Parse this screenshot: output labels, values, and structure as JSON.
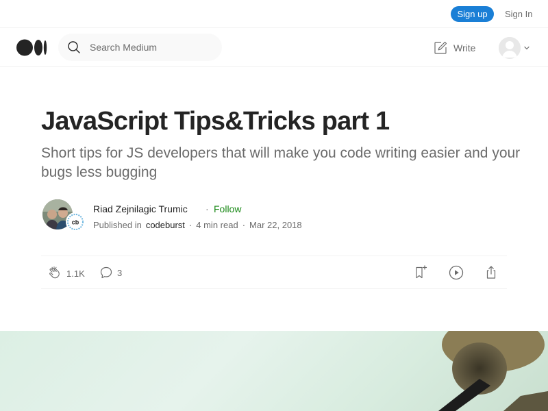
{
  "topbar": {
    "signup_label": "Sign up",
    "signin_label": "Sign In"
  },
  "navbar": {
    "logo": "medium-logo",
    "search": {
      "placeholder": "Search Medium",
      "value": ""
    },
    "write_label": "Write"
  },
  "article": {
    "title": "JavaScript Tips&Tricks part 1",
    "subtitle": "Short tips for JS developers that will make you code writing easier and your bugs less bugging",
    "author": {
      "name": "Riad Zejnilagic Trumic",
      "follow_label": "Follow",
      "separator": "·"
    },
    "publication": {
      "prefix": "Published in",
      "name": "codeburst",
      "badge_text": "cb",
      "read_time": "4 min read",
      "date": "Mar 22, 2018",
      "separator": "·"
    }
  },
  "actions": {
    "claps": "1.1K",
    "comments": "3"
  },
  "colors": {
    "signup_bg": "#1a7fd6",
    "follow": "#1a8917",
    "text_primary": "#242424",
    "text_secondary": "#6b6b6b"
  }
}
